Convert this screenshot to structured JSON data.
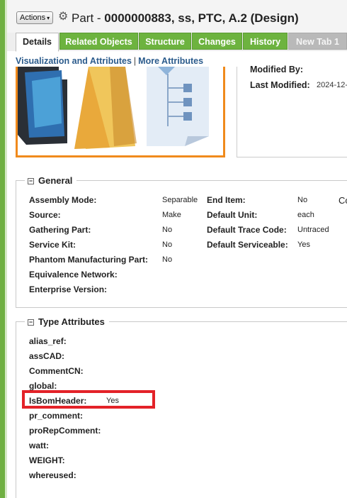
{
  "header": {
    "actions_label": "Actions",
    "title_prefix": "Part - ",
    "title_main": "0000000883, ss, PTC, A.2 (Design)"
  },
  "tabs": [
    {
      "label": "Details"
    },
    {
      "label": "Related Objects"
    },
    {
      "label": "Structure"
    },
    {
      "label": "Changes"
    },
    {
      "label": "History"
    },
    {
      "label": "New Tab 1"
    }
  ],
  "subnav": {
    "visualization": "Visualization and Attributes",
    "more": "More Attributes"
  },
  "meta": {
    "modified_by_label": "Modified By:",
    "last_modified_label": "Last Modified:",
    "last_modified_value": "2024-12-"
  },
  "general": {
    "title": "General",
    "left": [
      {
        "label": "Assembly Mode:",
        "value": "Separable"
      },
      {
        "label": "Source:",
        "value": "Make"
      },
      {
        "label": "Gathering Part:",
        "value": "No"
      },
      {
        "label": "Service Kit:",
        "value": "No"
      },
      {
        "label": "Phantom Manufacturing Part:",
        "value": "No"
      },
      {
        "label": "Equivalence Network:",
        "value": ""
      },
      {
        "label": "Enterprise Version:",
        "value": ""
      }
    ],
    "right": [
      {
        "label": "End Item:",
        "value": "No"
      },
      {
        "label": "Default Unit:",
        "value": "each"
      },
      {
        "label": "Default Trace Code:",
        "value": "Untraced"
      },
      {
        "label": "Default Serviceable:",
        "value": "Yes"
      }
    ],
    "overflow_text": "Co"
  },
  "type_attributes": {
    "title": "Type Attributes",
    "rows": [
      {
        "label": "alias_ref:",
        "value": ""
      },
      {
        "label": "assCAD:",
        "value": ""
      },
      {
        "label": "CommentCN:",
        "value": ""
      },
      {
        "label": "global:",
        "value": ""
      },
      {
        "label": "IsBomHeader:",
        "value": "Yes"
      },
      {
        "label": "pr_comment:",
        "value": ""
      },
      {
        "label": "proRepComment:",
        "value": ""
      },
      {
        "label": "watt:",
        "value": ""
      },
      {
        "label": "WEIGHT:",
        "value": ""
      },
      {
        "label": "whereused:",
        "value": ""
      }
    ]
  },
  "colors": {
    "tab_green": "#6db33f",
    "link_blue": "#2b5b8c",
    "thumbnail_border": "#f08a1c",
    "highlight_red": "#e32228"
  }
}
